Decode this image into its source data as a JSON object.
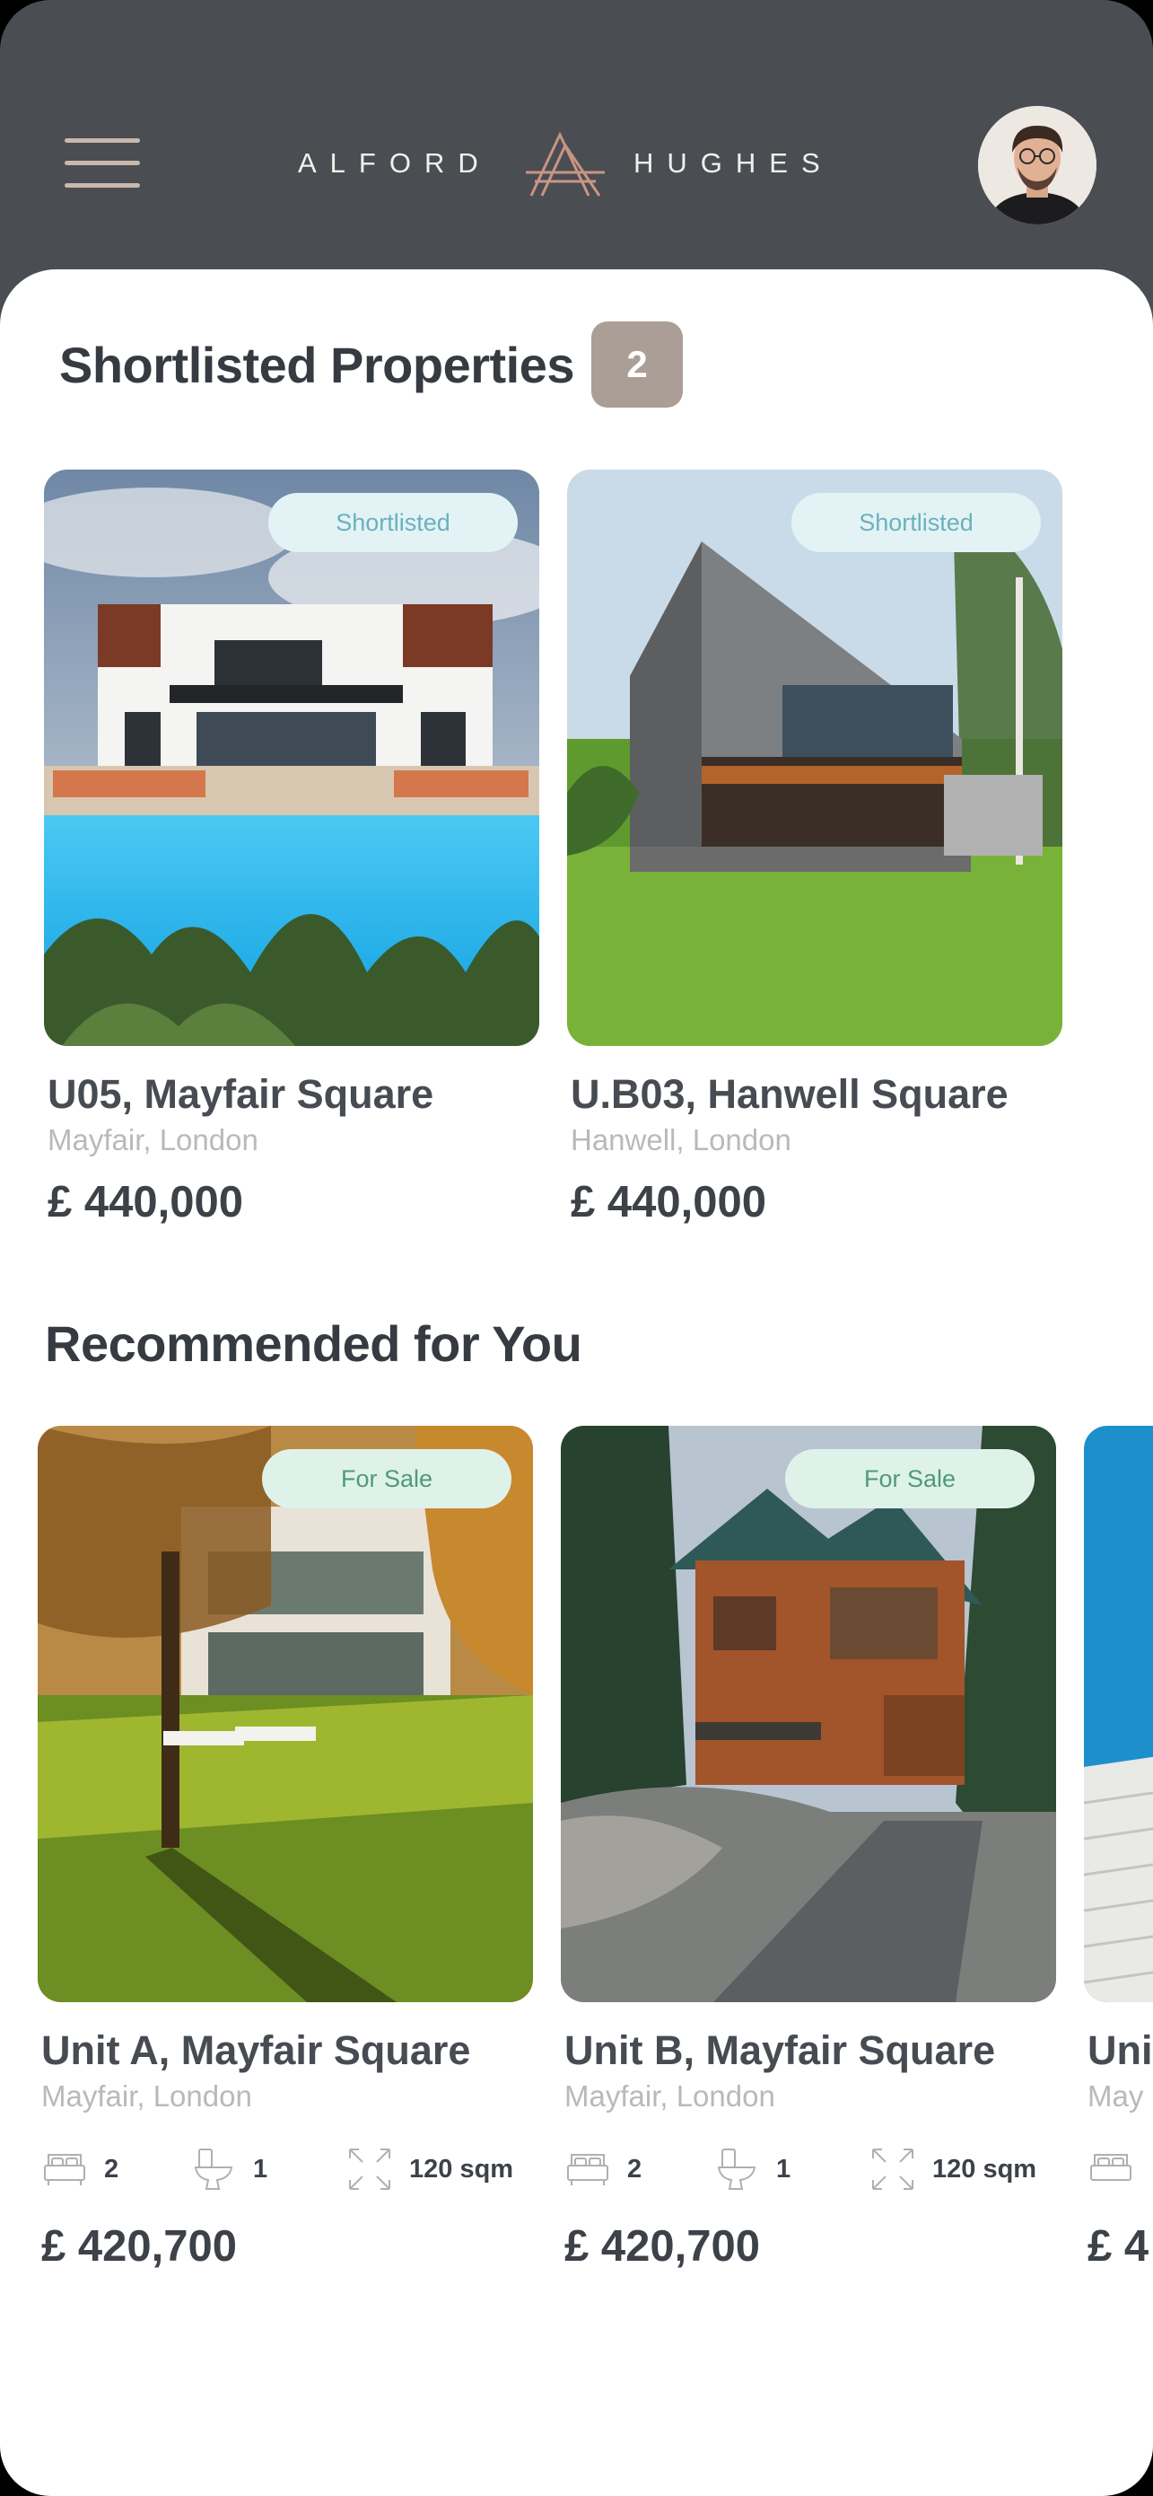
{
  "brand": {
    "left": "ALFORD",
    "right": "HUGHES"
  },
  "shortlisted": {
    "title": "Shortlisted Properties",
    "count": "2",
    "items": [
      {
        "tag": "Shortlisted",
        "name": "U05, Mayfair Square",
        "location": "Mayfair, London",
        "price": "£ 440,000"
      },
      {
        "tag": "Shortlisted",
        "name": "U.B03, Hanwell Square",
        "location": "Hanwell, London",
        "price": "£ 440,000"
      }
    ]
  },
  "recommended": {
    "title": "Recommended for You",
    "items": [
      {
        "tag": "For Sale",
        "name": "Unit A, Mayfair Square",
        "location": "Mayfair, London",
        "beds": "2",
        "baths": "1",
        "area": "120 sqm",
        "price": "£ 420,700"
      },
      {
        "tag": "For Sale",
        "name": "Unit B, Mayfair Square",
        "location": "Mayfair, London",
        "beds": "2",
        "baths": "1",
        "area": "120 sqm",
        "price": "£ 420,700"
      },
      {
        "tag": "",
        "name": "Uni",
        "location": "May",
        "beds": "",
        "baths": "",
        "area": "",
        "price": "£ 4"
      }
    ]
  },
  "colors": {
    "header_bg": "#4a4d52",
    "accent_badge": "#ab9e96",
    "shortlisted_tag_bg": "#e3f3f5",
    "forsale_tag_bg": "#dff2ea"
  },
  "icons": [
    "menu-icon",
    "brand-logo",
    "avatar",
    "bed-icon",
    "toilet-icon",
    "area-icon"
  ]
}
